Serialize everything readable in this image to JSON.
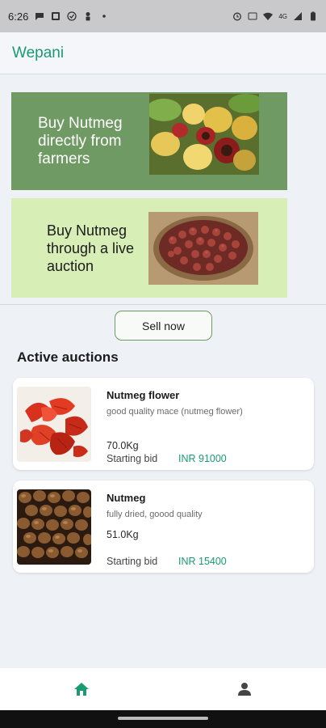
{
  "status_bar": {
    "time": "6:26",
    "network_label": "4G",
    "icons": [
      "chat-icon",
      "photo-icon",
      "check-circle-icon",
      "person-icon",
      "dot-icon",
      "alarm-icon",
      "volte-icon",
      "wifi-icon",
      "signal-icon",
      "battery-icon"
    ]
  },
  "app_bar": {
    "title": "Wepani"
  },
  "banners": [
    {
      "text": "Buy Nutmeg directly from farmers",
      "bg_color": "#6f9a63"
    },
    {
      "text": "Buy Nutmeg through a live auction",
      "bg_color": "#d7eeb6"
    }
  ],
  "sell_button": {
    "label": "Sell now"
  },
  "active_auctions": {
    "title": "Active auctions",
    "items": [
      {
        "name": "Nutmeg flower",
        "description": "good quality mace (nutmeg flower)",
        "quantity": "70.0Kg",
        "bid_label": "Starting bid",
        "bid_value": "INR 91000"
      },
      {
        "name": "Nutmeg",
        "description": "fully dried, goood quality",
        "quantity": "51.0Kg",
        "bid_label": "Starting bid",
        "bid_value": "INR 15400"
      }
    ]
  },
  "bottom_nav": {
    "items": [
      {
        "icon": "home-icon",
        "active": true
      },
      {
        "icon": "person-icon",
        "active": false
      }
    ]
  },
  "colors": {
    "accent": "#1a9a73",
    "banner_dark": "#6f9a63",
    "banner_light": "#d7eeb6"
  }
}
